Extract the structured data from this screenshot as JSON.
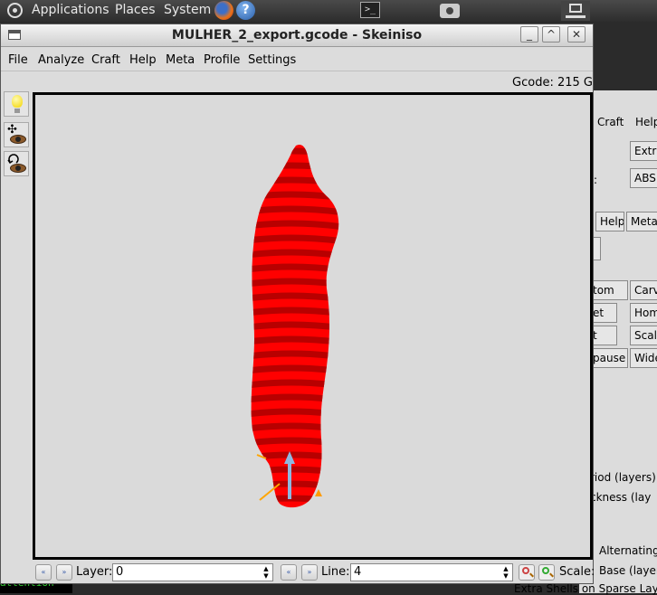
{
  "panel": {
    "applications": "Applications",
    "places": "Places",
    "system": "System",
    "help_glyph": "?",
    "terminal_glyph": ">_"
  },
  "window": {
    "title": "MULHER_2_export.gcode - Skeiniso",
    "menu": [
      "File",
      "Analyze",
      "Craft",
      "Help",
      "Meta",
      "Profile",
      "Settings"
    ],
    "status": "Gcode: 215 G",
    "controls": {
      "minimize": "_",
      "maximize": "^",
      "close": "✕"
    }
  },
  "toolbar": {
    "move_glyph": "✣"
  },
  "bottom": {
    "layer_label": "Layer:",
    "layer_value": "0",
    "line_label": "Line:",
    "line_value": "4",
    "scale_label": "Scale:",
    "nav_back": "«",
    "nav_fwd": "»"
  },
  "background_window": {
    "menu": [
      "Craft",
      "Help"
    ],
    "buttons": [
      "Extr",
      "ABS",
      "Help",
      "Meta",
      "tom",
      "Carv",
      "et",
      "Hom",
      "t",
      "Scal",
      "pause",
      "Wide"
    ],
    "texts": [
      ":",
      "riod (layers)",
      "ckness (lay",
      "Alternating",
      "Base (layer",
      "Extra Shells on Sparse Lay"
    ]
  },
  "terminal_strip": "attention",
  "colors": {
    "model_red": "#ff0000",
    "model_dark_red": "#b80000",
    "viewport_bg": "#dadada",
    "axis_arrow": "#8fb8e0",
    "axis_orange": "#ff9a00"
  }
}
